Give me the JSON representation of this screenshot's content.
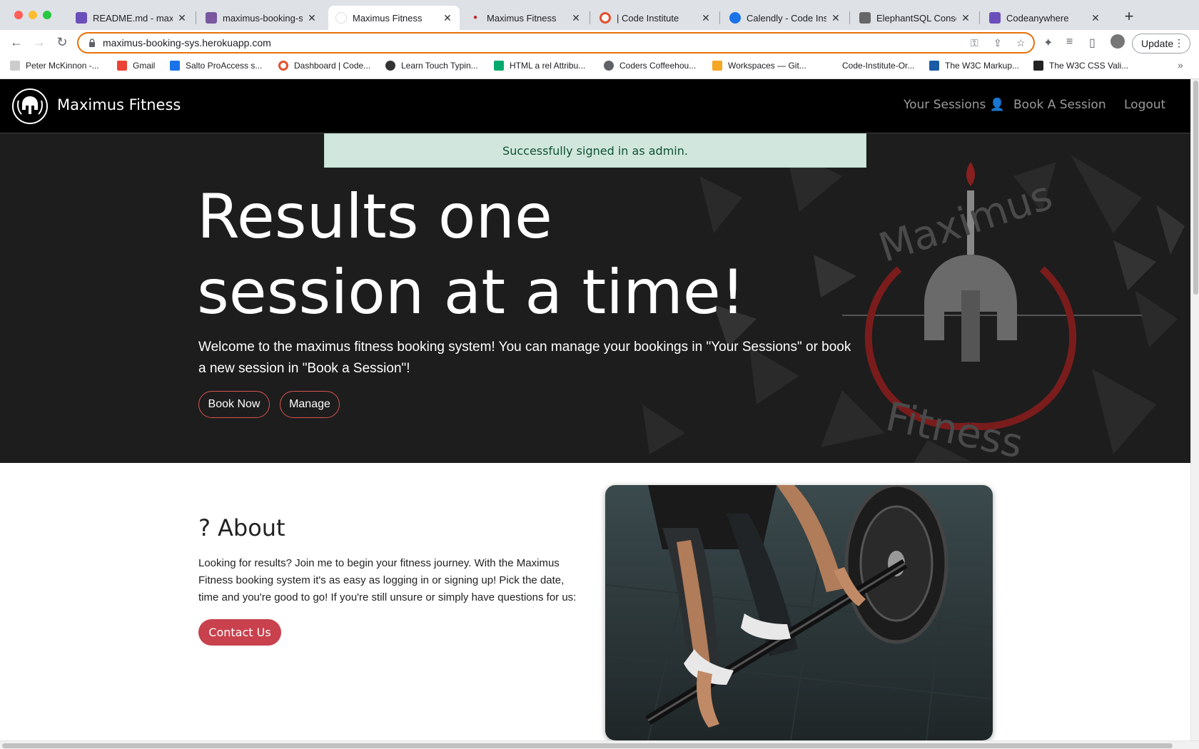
{
  "browser": {
    "tabs": [
      {
        "title": "README.md - maxim",
        "favicon": "gitpod-icon",
        "color": "#6b4fbb"
      },
      {
        "title": "maximus-booking-sy",
        "favicon": "heroku-icon",
        "color": "#79589f"
      },
      {
        "title": "Maximus Fitness",
        "favicon": "maximus-icon",
        "color": "#b22"
      },
      {
        "title": "Maximus Fitness",
        "favicon": "maximus-icon",
        "color": "#b22"
      },
      {
        "title": "| Code Institute",
        "favicon": "code-institute-icon",
        "color": "#e4502d"
      },
      {
        "title": "Calendly - Code Insti",
        "favicon": "calendly-icon",
        "color": "#1a73e8"
      },
      {
        "title": "ElephantSQL Consol",
        "favicon": "elephantsql-icon",
        "color": "#555"
      },
      {
        "title": "Codeanywhere",
        "favicon": "codeanywhere-icon",
        "color": "#6b4fbb"
      }
    ],
    "url": "maximus-booking-sys.herokuapp.com",
    "update_label": "Update",
    "bookmarks": [
      {
        "label": "Peter McKinnon -...",
        "icon": "bookmark-icon",
        "color": "#bbb"
      },
      {
        "label": "Gmail",
        "icon": "gmail-icon",
        "color": "#ea4335"
      },
      {
        "label": "Salto ProAccess s...",
        "icon": "salto-icon",
        "color": "#1a73e8"
      },
      {
        "label": "Dashboard | Code...",
        "icon": "code-institute-icon",
        "color": "#e4502d"
      },
      {
        "label": "Learn Touch Typin...",
        "icon": "typing-icon",
        "color": "#333"
      },
      {
        "label": "HTML a rel Attribu...",
        "icon": "w3schools-icon",
        "color": "#04aa6d"
      },
      {
        "label": "Coders Coffeehou...",
        "icon": "globe-icon",
        "color": "#5f6368"
      },
      {
        "label": "Workspaces — Git...",
        "icon": "gitpod-icon",
        "color": "#f5a623"
      },
      {
        "label": "Code-Institute-Or...",
        "icon": "folder-icon",
        "color": "#fff"
      },
      {
        "label": "The W3C Markup...",
        "icon": "w3c-icon",
        "color": "#1a5aa6"
      },
      {
        "label": "The W3C CSS Vali...",
        "icon": "w3c-css-icon",
        "color": "#222"
      }
    ]
  },
  "site": {
    "brand": "Maximus Fitness",
    "nav": {
      "sessions": "Your Sessions",
      "book": "Book A Session",
      "logout": "Logout"
    },
    "alert": "Successfully signed in as admin.",
    "hero": {
      "line1": "Results one",
      "line2": "session at a time!",
      "subtext": "Welcome to the maximus fitness booking system! You can manage your bookings in \"Your Sessions\" or book a new session in \"Book a Session\"!",
      "book_now": "Book Now",
      "manage": "Manage",
      "watermark_top": "Maximus",
      "watermark_bottom": "Fitness"
    },
    "about": {
      "title": "About",
      "text": "Looking for results? Join me to begin your fitness journey. With the Maximus Fitness booking system it's as easy as logging in or signing up! Pick the date, time and you're good to go! If you're still unsure or simply have questions for us:",
      "contact": "Contact Us"
    }
  }
}
